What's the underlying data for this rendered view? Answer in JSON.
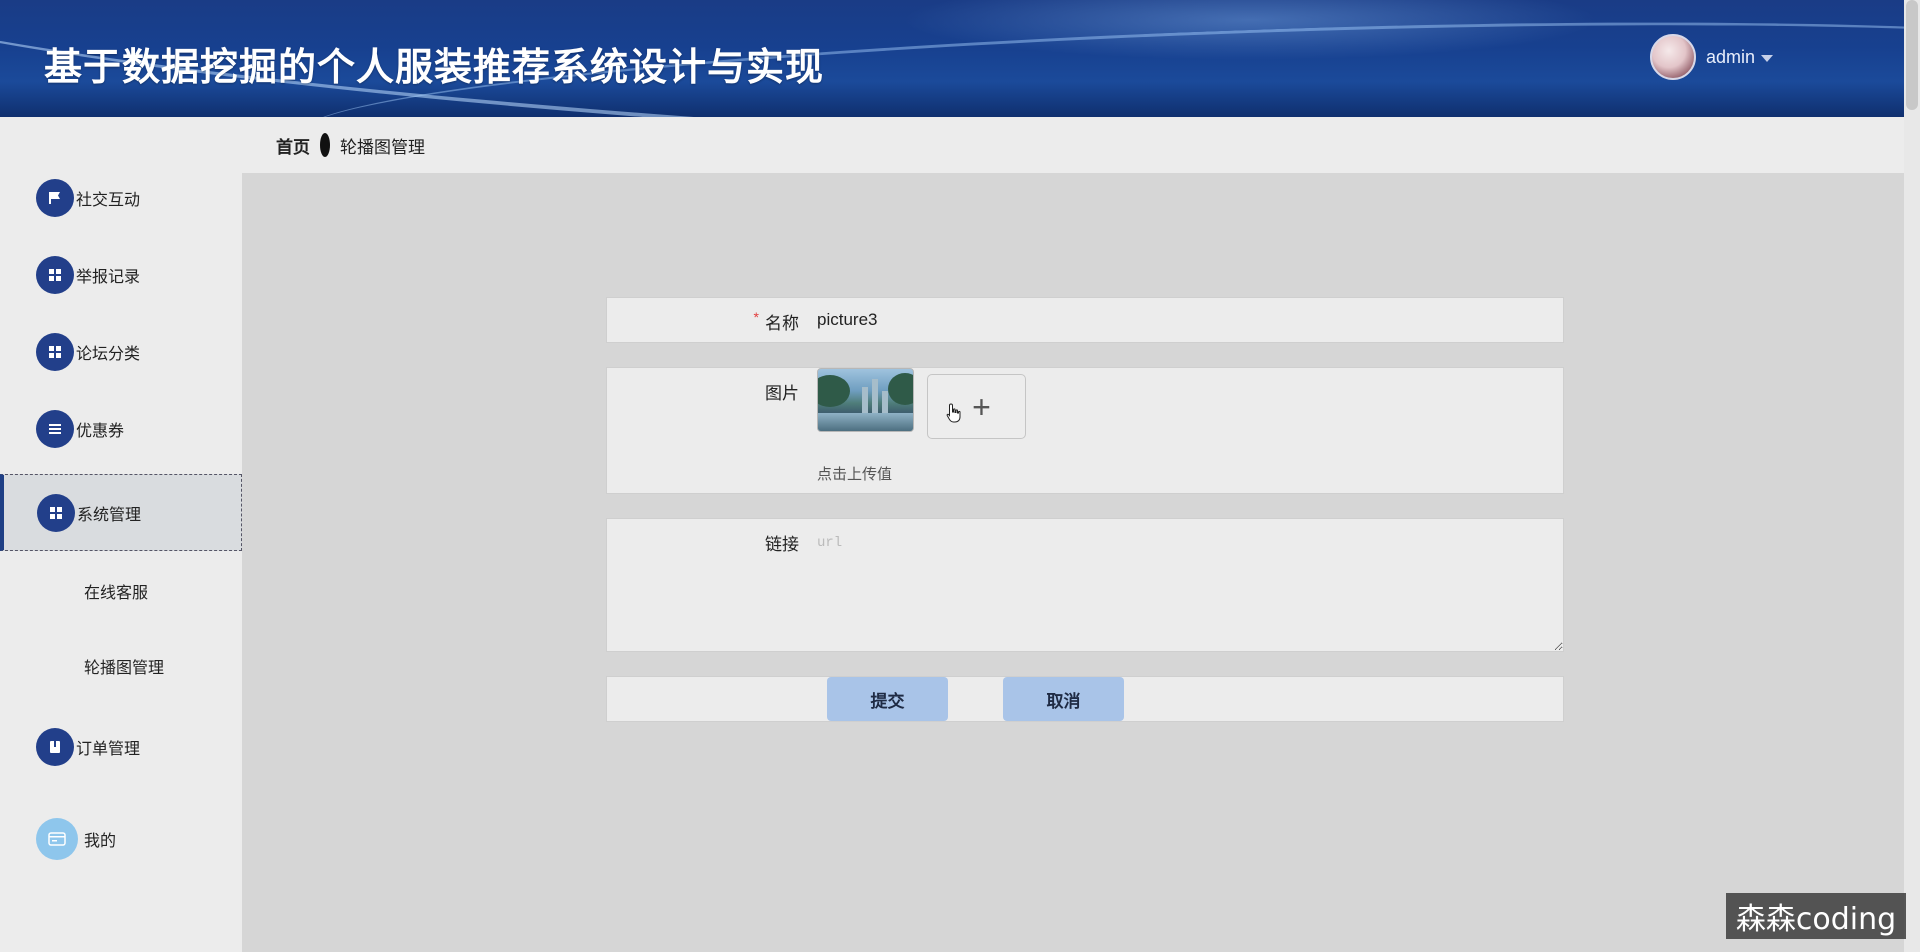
{
  "header": {
    "title": "基于数据挖掘的个人服装推荐系统设计与实现",
    "user_name": "admin"
  },
  "sidebar": {
    "items": [
      {
        "label": "社交互动",
        "icon": "flag-icon"
      },
      {
        "label": "举报记录",
        "icon": "grid-icon"
      },
      {
        "label": "论坛分类",
        "icon": "grid-icon"
      },
      {
        "label": "优惠券",
        "icon": "list-icon"
      },
      {
        "label": "系统管理",
        "icon": "grid-icon",
        "active": true
      },
      {
        "label": "订单管理",
        "icon": "book-icon"
      },
      {
        "label": "我的",
        "icon": "card-icon"
      }
    ],
    "sub_items": [
      {
        "label": "在线客服"
      },
      {
        "label": "轮播图管理"
      }
    ]
  },
  "breadcrumb": {
    "home": "首页",
    "current": "轮播图管理"
  },
  "form": {
    "name_label": "名称",
    "name_required": "*",
    "name_value": "picture3",
    "image_label": "图片",
    "upload_tip": "点击上传值",
    "link_label": "链接",
    "link_placeholder": "url",
    "submit_label": "提交",
    "cancel_label": "取消"
  },
  "watermark": "森森coding",
  "colors": {
    "header_blue": "#1a3c86",
    "icon_blue": "#223f8a",
    "button_blue": "#a9c4e8",
    "required_red": "#e23b3b"
  }
}
